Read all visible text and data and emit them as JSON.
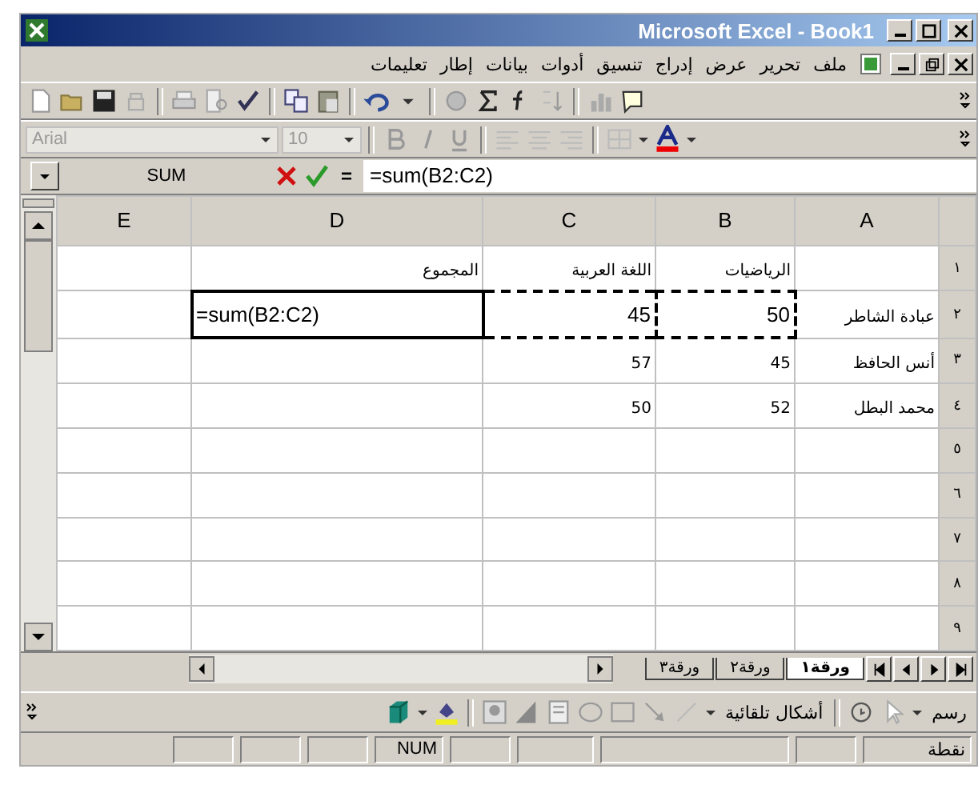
{
  "window": {
    "title": "Microsoft Excel - Book1"
  },
  "menu": [
    "ملف",
    "تحرير",
    "عرض",
    "إدراج",
    "تنسيق",
    "أدوات",
    "بيانات",
    "إطار",
    "تعليمات"
  ],
  "formatting": {
    "font": "Arial",
    "size": "10"
  },
  "formula_bar": {
    "name_box": "SUM",
    "equals": "=",
    "formula": "=sum(B2:C2)"
  },
  "columns": [
    {
      "label": "A"
    },
    {
      "label": "B"
    },
    {
      "label": "C"
    },
    {
      "label": "D"
    },
    {
      "label": "E"
    }
  ],
  "rows": [
    {
      "label": "١",
      "cells": [
        {
          "kind": "empty"
        },
        {
          "kind": "plain",
          "text": "الرياضيات"
        },
        {
          "kind": "plain",
          "text": "اللغة العربية"
        },
        {
          "kind": "plain",
          "text": "المجموع"
        },
        {
          "kind": "empty"
        }
      ]
    },
    {
      "label": "٢",
      "cells": [
        {
          "kind": "plain",
          "text": "عبادة الشاطر"
        },
        {
          "kind": "marquee",
          "text": "50"
        },
        {
          "kind": "marquee",
          "text": "45"
        },
        {
          "kind": "editing",
          "text": "=sum(B2:C2)"
        },
        {
          "kind": "empty"
        }
      ]
    },
    {
      "label": "٣",
      "cells": [
        {
          "kind": "plain",
          "text": "أنس الحافظ"
        },
        {
          "kind": "plain",
          "text": "45"
        },
        {
          "kind": "plain",
          "text": "57"
        },
        {
          "kind": "empty"
        },
        {
          "kind": "empty"
        }
      ]
    },
    {
      "label": "٤",
      "cells": [
        {
          "kind": "plain",
          "text": "محمد البطل"
        },
        {
          "kind": "plain",
          "text": "52"
        },
        {
          "kind": "plain",
          "text": "50"
        },
        {
          "kind": "empty"
        },
        {
          "kind": "empty"
        }
      ]
    },
    {
      "label": "٥",
      "cells": [
        {
          "kind": "empty"
        },
        {
          "kind": "empty"
        },
        {
          "kind": "empty"
        },
        {
          "kind": "empty"
        },
        {
          "kind": "empty"
        }
      ]
    },
    {
      "label": "٦",
      "cells": [
        {
          "kind": "empty"
        },
        {
          "kind": "empty"
        },
        {
          "kind": "empty"
        },
        {
          "kind": "empty"
        },
        {
          "kind": "empty"
        }
      ]
    },
    {
      "label": "٧",
      "cells": [
        {
          "kind": "empty"
        },
        {
          "kind": "empty"
        },
        {
          "kind": "empty"
        },
        {
          "kind": "empty"
        },
        {
          "kind": "empty"
        }
      ]
    },
    {
      "label": "٨",
      "cells": [
        {
          "kind": "empty"
        },
        {
          "kind": "empty"
        },
        {
          "kind": "empty"
        },
        {
          "kind": "empty"
        },
        {
          "kind": "empty"
        }
      ]
    },
    {
      "label": "٩",
      "cells": [
        {
          "kind": "empty"
        },
        {
          "kind": "empty"
        },
        {
          "kind": "empty"
        },
        {
          "kind": "empty"
        },
        {
          "kind": "empty"
        }
      ]
    }
  ],
  "sheet_tabs": [
    {
      "label": "ورقة١",
      "selected": true
    },
    {
      "label": "ورقة٢",
      "selected": false
    },
    {
      "label": "ورقة٣",
      "selected": false
    }
  ],
  "drawing_toolbar": {
    "draw": "رسم",
    "autoshapes": "أشكال تلقائية"
  },
  "status_bar": {
    "mode": "نقطة",
    "num": "NUM"
  }
}
